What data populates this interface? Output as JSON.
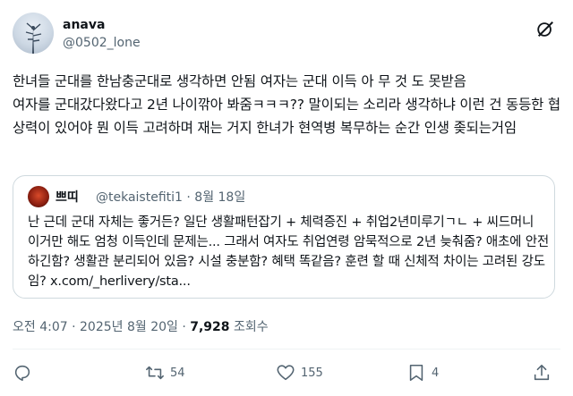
{
  "author": {
    "name": "anava",
    "handle": "@0502_lone"
  },
  "icons": {
    "header_right": "grok-icon",
    "reply": "reply-icon",
    "repost": "repost-icon",
    "like": "heart-icon",
    "bookmark": "bookmark-icon",
    "share": "share-icon"
  },
  "post": {
    "text": "한녀들 군대를 한남충군대로 생각하면 안됨 여자는 군대 이득 아 무 것 도 못받음\n여자를 군대갔다왔다고 2년 나이깎아 봐줌ㅋㅋㅋ?? 말이되는 소리라 생각하냐 이런 건 동등한 협상력이 있어야 뭔 이득 고려하며 재는 거지 한녀가 현역병 복무하는 순간 인생 좆되는거임"
  },
  "quote": {
    "name": "쁘띠",
    "handle_date": "@tekaistefiti1 · 8월 18일",
    "text": "난 근데 군대 자체는 좋거든? 일단 생활패턴잡기 + 체력증진 + 취업2년미루기ㄱㄴ + 씨드머니 이거만 해도 엄청 이득인데 문제는... 그래서 여자도 취업연령 암묵적으로 2년 늦춰줌? 애초에 안전하긴함? 생활관 분리되어 있음? 시설 충분함? 혜택 똑같음? 훈련 할 때 신체적 차이는 고려된 강도임? x.com/_herlivery/sta..."
  },
  "meta": {
    "timestamp": "오전 4:07 · 2025년 8월 20일 · ",
    "views": "7,928",
    "views_label": " 조회수"
  },
  "actions": {
    "reposts": "54",
    "likes": "155",
    "bookmarks": "4"
  },
  "colors": {
    "text": "#0f1419",
    "secondary": "#536471",
    "border": "#cfd9de"
  }
}
